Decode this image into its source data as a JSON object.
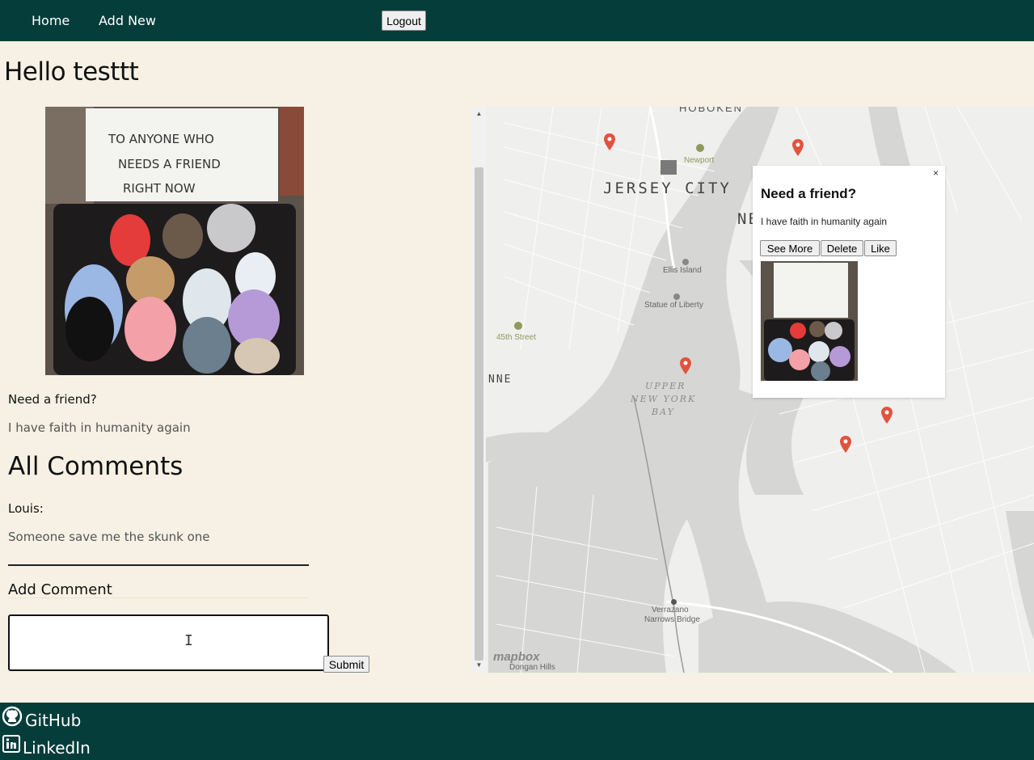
{
  "nav": {
    "home": "Home",
    "add_new": "Add New",
    "logout": "Logout"
  },
  "greeting": "Hello testtt",
  "post": {
    "title": "Need a friend?",
    "description": "I have faith in humanity again",
    "sign_text": [
      "TO ANYONE WHO",
      "NEEDS A FRIEND",
      "RIGHT NOW"
    ]
  },
  "comments": {
    "heading": "All Comments",
    "items": [
      {
        "author": "Louis:",
        "text": "Someone save me the skunk one"
      }
    ],
    "add_heading": "Add Comment",
    "input_value": "",
    "submit_label": "Submit"
  },
  "map": {
    "labels": {
      "hoboken": "HOBOKEN",
      "jersey_city": "JERSEY CITY",
      "newport": "Newport",
      "ellis_island": "Ellis Island",
      "statue_of_liberty": "Statue of Liberty",
      "street_45": "45th Street",
      "bay_line1": "UPPER",
      "bay_line2": "NEW YORK",
      "bay_line3": "BAY",
      "verrazano_1": "Verrazano",
      "verrazano_2": "Narrows Bridge",
      "dongan": "Dongan Hills",
      "nne": "NNE",
      "ne": "NE"
    },
    "attribution": "mapbox",
    "popup": {
      "close": "×",
      "title": "Need a friend?",
      "description": "I have faith in humanity again",
      "see_more": "See More",
      "delete": "Delete",
      "like": "Like"
    },
    "marker_color": "#e0533e"
  },
  "footer": {
    "github": "GitHub",
    "linkedin": "LinkedIn"
  },
  "colors": {
    "nav_bg": "#053d3b",
    "page_bg": "#f6f1e4"
  },
  "icons": {
    "github": "github-icon",
    "linkedin": "linkedin-icon",
    "marker": "map-marker-icon"
  }
}
